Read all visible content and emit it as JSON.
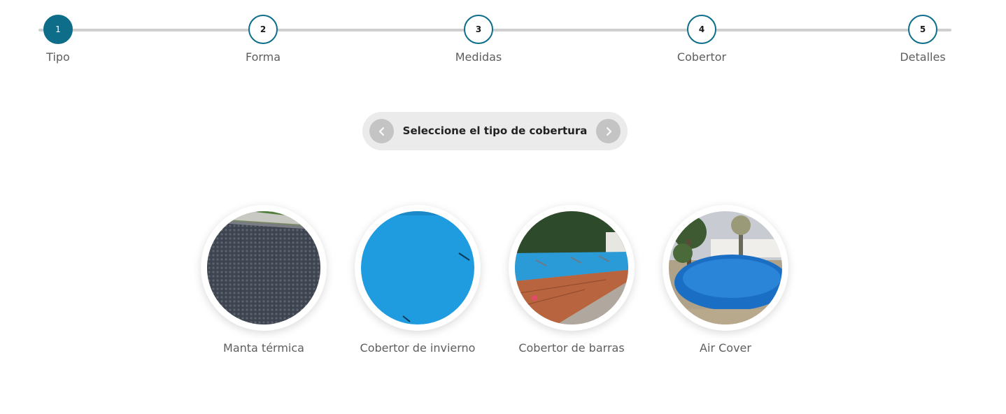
{
  "stepper": {
    "steps": [
      {
        "number": "1",
        "label": "Tipo",
        "state": "active"
      },
      {
        "number": "2",
        "label": "Forma",
        "state": "pending"
      },
      {
        "number": "3",
        "label": "Medidas",
        "state": "pending"
      },
      {
        "number": "4",
        "label": "Cobertor",
        "state": "pending"
      },
      {
        "number": "5",
        "label": "Detalles",
        "state": "pending"
      }
    ],
    "colors": {
      "accent": "#0e6e8a",
      "track": "#cfcfcf"
    }
  },
  "selector": {
    "title": "Seleccione el tipo de cobertura",
    "prev_icon": "chevron-left-icon",
    "next_icon": "chevron-right-icon"
  },
  "options": [
    {
      "label": "Manta térmica",
      "image": "thermal-blanket-photo"
    },
    {
      "label": "Cobertor de invierno",
      "image": "winter-cover-photo"
    },
    {
      "label": "Cobertor de barras",
      "image": "bar-cover-photo"
    },
    {
      "label": "Air Cover",
      "image": "air-cover-photo"
    }
  ]
}
